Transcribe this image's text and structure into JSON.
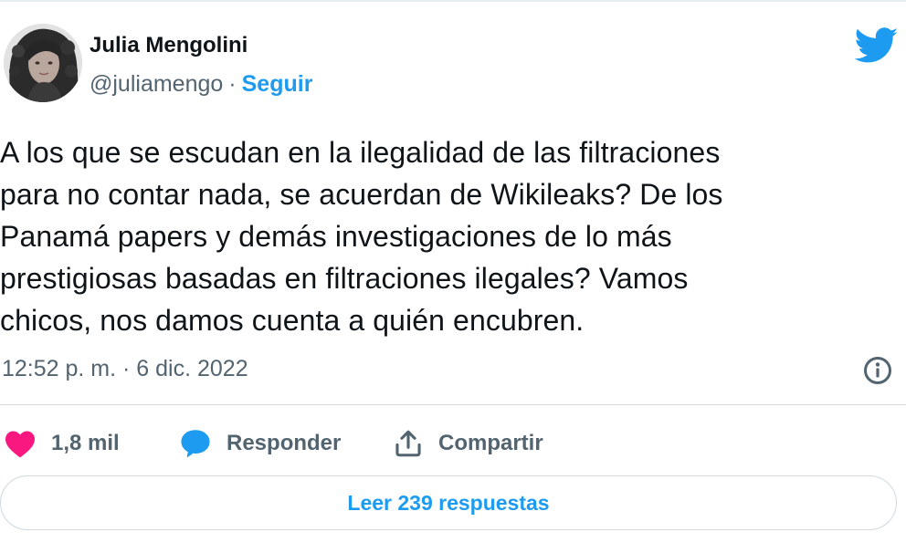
{
  "author": {
    "name": "Julia Mengolini",
    "handle": "@juliamengo",
    "separator": "·",
    "follow_label": "Seguir"
  },
  "tweet": {
    "text": "A los que se escudan en la ilegalidad de las filtraciones\npara no contar nada, se acuerdan de Wikileaks? De los\nPanamá papers y demás investigaciones de lo más\nprestigiosas basadas en filtraciones ilegales? Vamos\nchicos, nos damos cuenta a quién encubren.",
    "timestamp": "12:52 p. m. · 6 dic. 2022"
  },
  "actions": {
    "likes_count": "1,8 mil",
    "reply_label": "Responder",
    "share_label": "Compartir"
  },
  "footer": {
    "read_replies_label": "Leer 239 respuestas"
  },
  "icons": {
    "brand": "twitter-bird-icon",
    "like": "heart-icon",
    "reply": "speech-bubble-icon",
    "share": "share-upload-icon",
    "info": "info-icon"
  },
  "colors": {
    "brand_blue": "#1d9bf0",
    "like_pink": "#f91880",
    "text_primary": "#0f1419",
    "text_secondary": "#536471",
    "border": "#cfd9de"
  }
}
